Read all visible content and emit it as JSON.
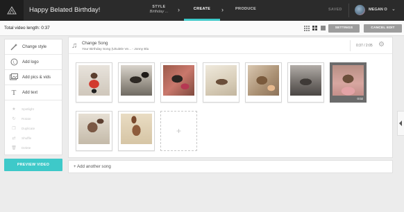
{
  "header": {
    "project_title": "Happy Belated Birthday!",
    "steps": [
      {
        "label": "STYLE",
        "sub": "Birthday ...",
        "active": false
      },
      {
        "label": "CREATE",
        "active": true
      },
      {
        "label": "PRODUCE",
        "active": false
      }
    ],
    "chevron": "›",
    "saved_label": "SAVED",
    "user_name": "MEGAN O",
    "user_caret": "⌄"
  },
  "toolbar": {
    "video_length_label": "Total video length: 0:37",
    "settings_label": "SETTINGS",
    "cancel_label": "CANCEL EDIT"
  },
  "sidebar": {
    "items": [
      {
        "label": "Change style",
        "icon": "wand-icon"
      },
      {
        "label": "Add logo",
        "icon": "logo-icon"
      },
      {
        "label": "Add pics & vids",
        "icon": "image-icon"
      },
      {
        "label": "Add text",
        "icon": "text-icon"
      }
    ],
    "disabled_items": [
      {
        "label": "Spotlight",
        "icon": "star-icon"
      },
      {
        "label": "Rotate",
        "icon": "rotate-icon"
      },
      {
        "label": "Duplicate",
        "icon": "duplicate-icon"
      },
      {
        "label": "Shuffle",
        "icon": "shuffle-icon"
      },
      {
        "label": "Delete",
        "icon": "trash-icon"
      }
    ],
    "preview_label": "PREVIEW VIDEO"
  },
  "song": {
    "change_label": "Change Song",
    "name": "Your Birthday Song (Ukulele Ve... - Jonny Blu",
    "time": "0:37 / 2:05"
  },
  "media": {
    "selected_badge": "0:02",
    "add_tile_symbol": "+"
  },
  "add_song_label": "+ Add another song",
  "colors": {
    "accent": "#3ec9c9",
    "topbar": "#2b2b2b",
    "button_gray": "#9d9d9d"
  }
}
